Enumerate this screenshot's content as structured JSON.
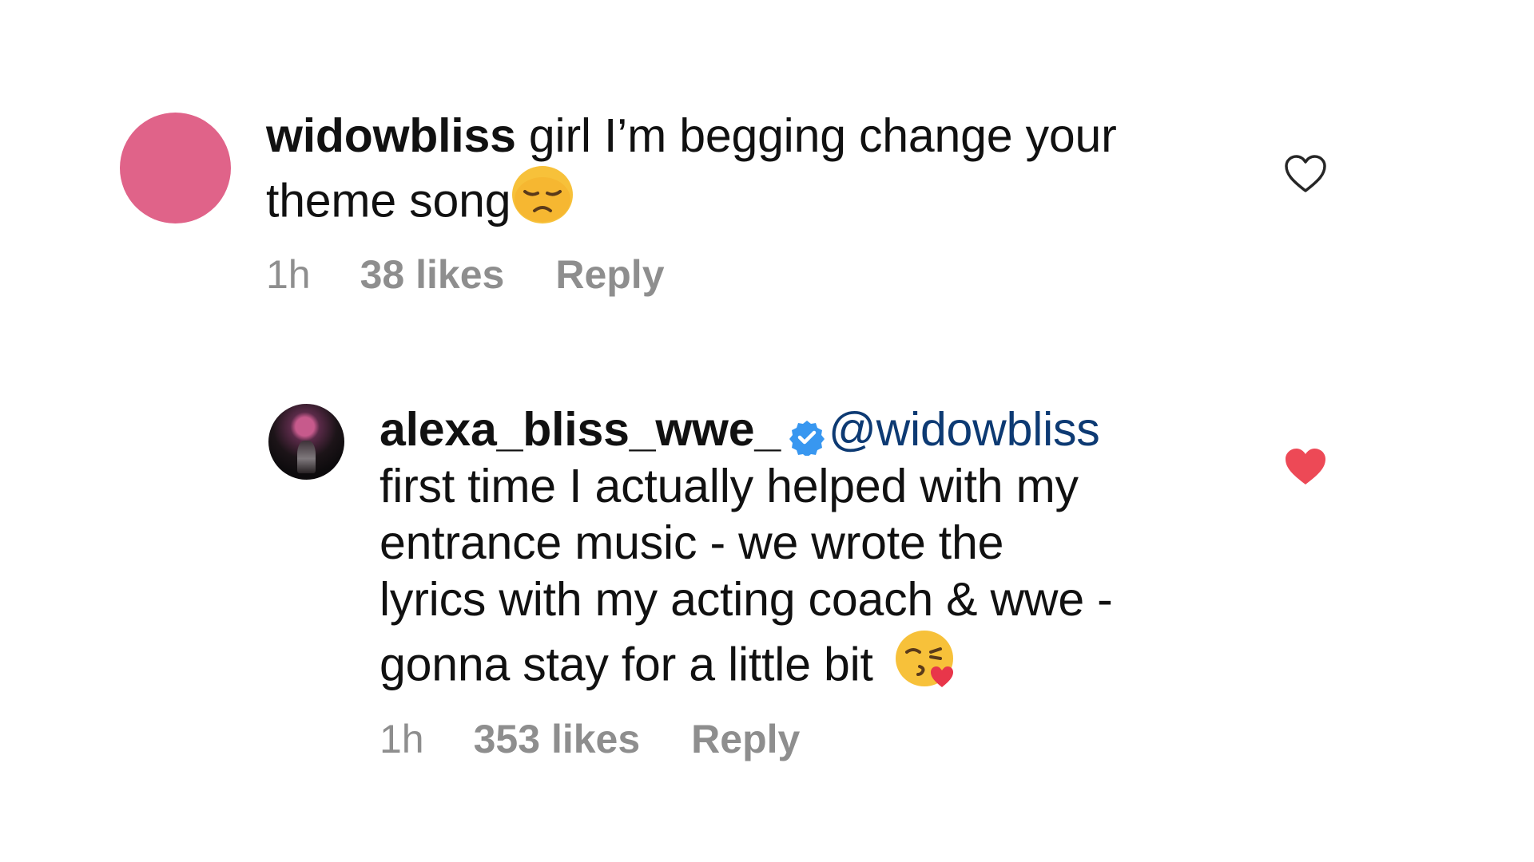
{
  "comments": [
    {
      "username": "widowbliss",
      "text_line1": "girl I’m begging change your",
      "text_line2": "theme song",
      "emoji": "disappointed-face",
      "time": "1h",
      "likes": "38 likes",
      "reply": "Reply",
      "liked": false,
      "avatar_color": "#e06389"
    },
    {
      "username": "alexa_bliss_wwe_",
      "verified": true,
      "mention": "@widowbliss",
      "lines": [
        "first time I actually helped with my",
        "entrance music - we wrote the",
        "lyrics with my acting coach & wwe -",
        "gonna stay for a little bit"
      ],
      "emoji": "face-blowing-a-kiss",
      "time": "1h",
      "likes": "353 likes",
      "reply": "Reply",
      "liked": true
    }
  ],
  "colors": {
    "heart_liked": "#ed4956",
    "heart_outline": "#262626",
    "meta_text": "#8e8e8e",
    "verified_badge": "#3897f0",
    "mention": "#0d3a73"
  }
}
